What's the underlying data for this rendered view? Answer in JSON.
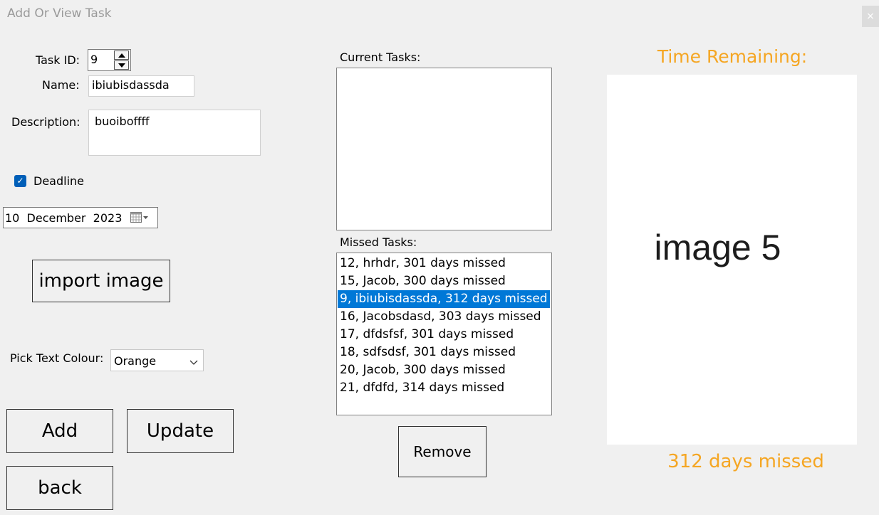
{
  "window": {
    "title": "Add Or View Task",
    "close_glyph": "×"
  },
  "form": {
    "task_id_label": "Task ID:",
    "task_id_value": "9",
    "name_label": "Name:",
    "name_value": "ibiubisdassda",
    "description_label": "Description:",
    "description_value": "buoiboffff",
    "deadline_label": "Deadline",
    "deadline_checked": true,
    "deadline_date": "10  December  2023",
    "import_image_label": "import image",
    "text_colour_label": "Pick Text Colour:",
    "text_colour_value": "Orange"
  },
  "buttons": {
    "add": "Add",
    "update": "Update",
    "back": "back",
    "remove": "Remove"
  },
  "current_tasks": {
    "label": "Current Tasks:",
    "items": []
  },
  "missed_tasks": {
    "label": "Missed Tasks:",
    "items": [
      "12, hrhdr, 301 days missed",
      "15, Jacob, 300 days missed",
      "9, ibiubisdassda, 312 days missed",
      "16, Jacobsdasd, 303 days missed",
      "17, dfdsfsf, 301 days missed",
      "18, sdfsdsf, 301 days missed",
      "20, Jacob, 300 days missed",
      "21, dfdfd, 314 days missed"
    ],
    "selected_index": 2
  },
  "preview": {
    "time_remaining_label": "Time Remaining:",
    "image_text": "image 5",
    "status_text": "312 days missed"
  },
  "colors": {
    "accent_text": "#f5a623",
    "selection": "#0078d7",
    "checkbox": "#005fb8"
  },
  "icons": {
    "calendar": "calendar-icon",
    "dropdown": "chevron-down-icon",
    "check": "check-icon"
  }
}
